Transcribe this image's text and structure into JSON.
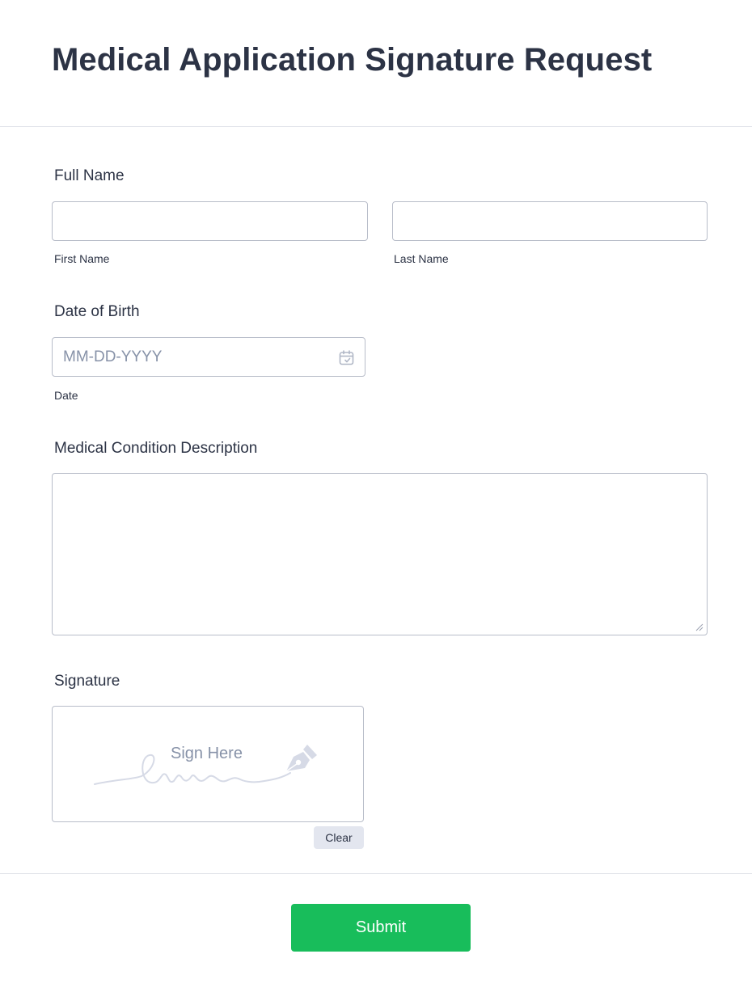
{
  "form": {
    "title": "Medical Application Signature Request",
    "full_name": {
      "label": "Full Name",
      "first_name": {
        "value": "",
        "sublabel": "First Name"
      },
      "last_name": {
        "value": "",
        "sublabel": "Last Name"
      }
    },
    "date_of_birth": {
      "label": "Date of Birth",
      "placeholder": "MM-DD-YYYY",
      "value": "",
      "sublabel": "Date",
      "icon": "calendar-icon"
    },
    "medical_condition": {
      "label": "Medical Condition Description",
      "value": ""
    },
    "signature": {
      "label": "Signature",
      "prompt": "Sign Here",
      "clear_label": "Clear",
      "icon": "pen-nib-icon"
    },
    "submit_label": "Submit"
  },
  "colors": {
    "title_text": "#2c3345",
    "input_border": "#b8bdc9",
    "placeholder": "#8792a8",
    "submit_bg": "#18bd5b",
    "clear_bg": "#e3e6ef",
    "divider": "#e3e5eb"
  }
}
